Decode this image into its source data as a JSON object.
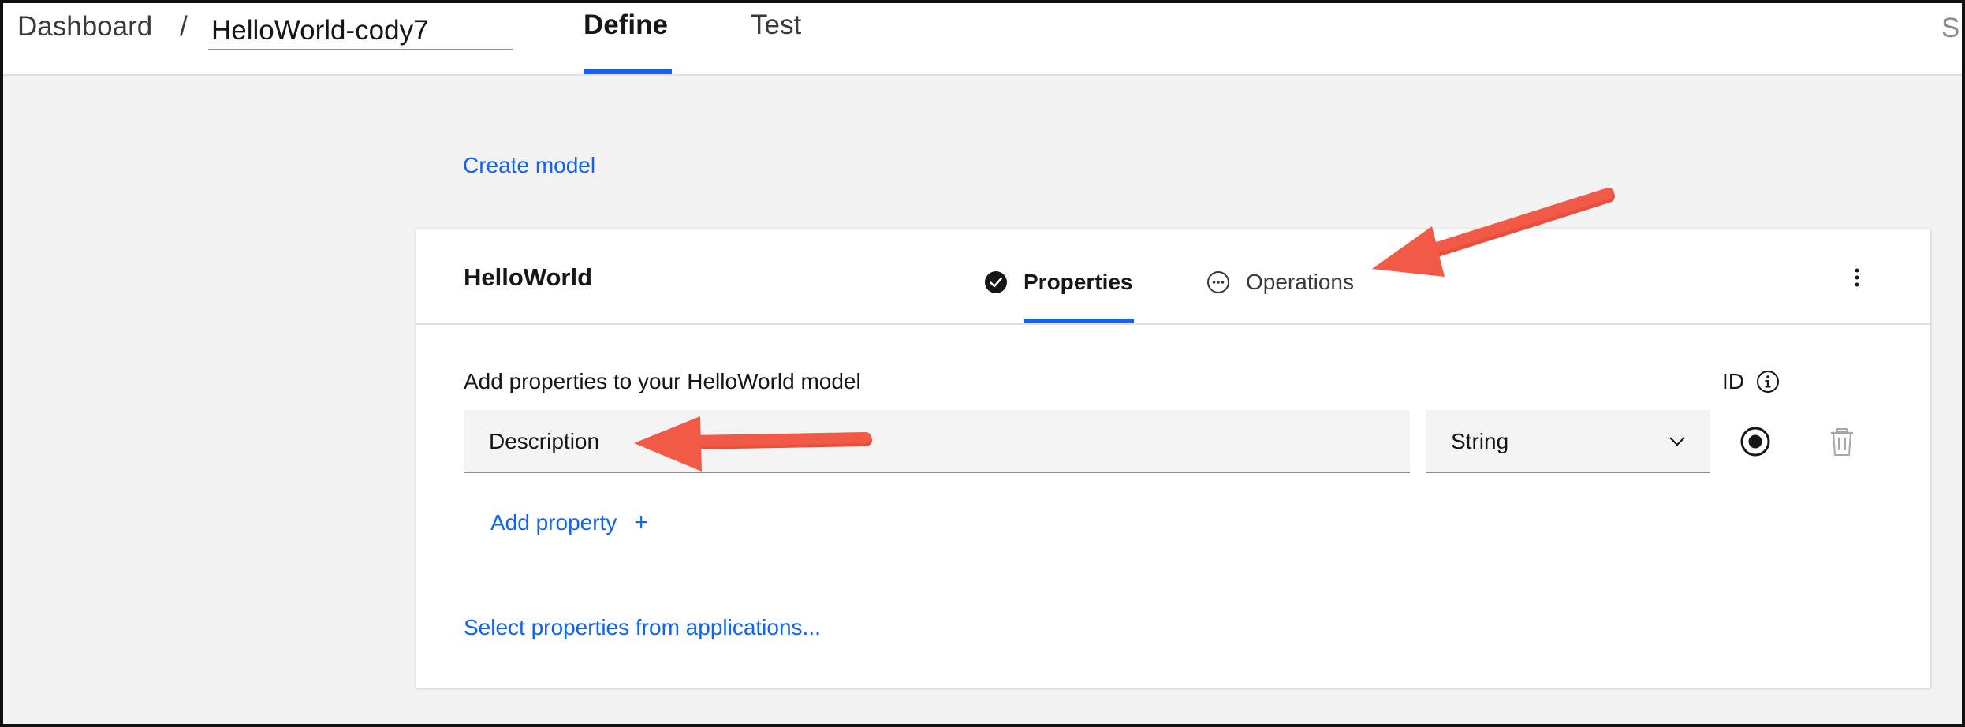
{
  "header": {
    "breadcrumb_root": "Dashboard",
    "breadcrumb_separator": "/",
    "api_name": "HelloWorld-cody7",
    "tabs": [
      {
        "label": "Define",
        "active": true
      },
      {
        "label": "Test",
        "active": false
      }
    ],
    "truncated_right_text": "S"
  },
  "main": {
    "create_model_link": "Create model",
    "model_card": {
      "title": "HelloWorld",
      "tabs": [
        {
          "label": "Properties",
          "active": true,
          "icon": "checkmark-filled-icon"
        },
        {
          "label": "Operations",
          "active": false,
          "icon": "overflow-circle-icon"
        }
      ],
      "overflow_icon": "overflow-menu-vertical-icon",
      "section_label": "Add properties to your HelloWorld model",
      "id_column_label": "ID",
      "properties": [
        {
          "name": "Description",
          "type": "String",
          "is_id": true
        }
      ],
      "add_property_label": "Add property",
      "add_property_icon": "+",
      "select_from_apps_link": "Select properties from applications..."
    }
  },
  "annotations": {
    "arrow_color": "#f15a47"
  },
  "colors": {
    "accent": "#0f62fe",
    "background": "#f3f3f3",
    "field_background": "#f4f4f4"
  }
}
